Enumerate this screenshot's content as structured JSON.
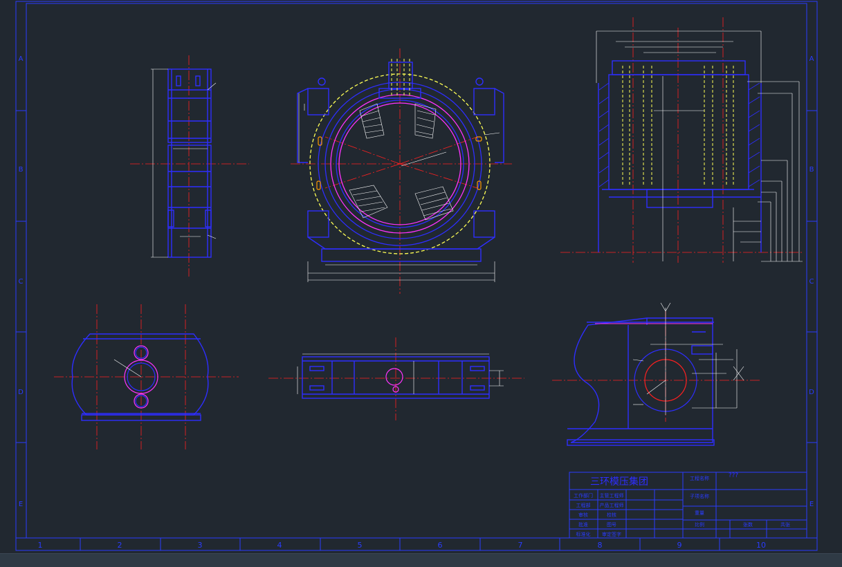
{
  "frame": {
    "column_labels": [
      "1",
      "2",
      "3",
      "4",
      "5",
      "6",
      "7",
      "8",
      "9",
      "10"
    ],
    "row_labels": [
      "A",
      "B",
      "C",
      "D",
      "E"
    ]
  },
  "title_block": {
    "drawing_title": "三环模压集团",
    "top_right_note": "???",
    "rows": [
      [
        "工作部门",
        "主管工程师",
        "",
        "",
        "",
        ""
      ],
      [
        "工程部",
        "产品工程师",
        "",
        "",
        "",
        ""
      ],
      [
        "审核",
        "校核",
        "",
        "",
        "",
        ""
      ],
      [
        "批准",
        "图号",
        "",
        "",
        "",
        ""
      ],
      [
        "标准化",
        "审定签字",
        "",
        "",
        "",
        ""
      ]
    ],
    "side_cells": [
      "工程名称",
      "子项名称",
      "重量",
      "比例",
      "张数",
      "共张"
    ]
  },
  "colors": {
    "background": "#212830",
    "frame": "#2a3cff",
    "geometry": "#2e2eff",
    "centerline": "#ff2020",
    "dimension": "#ffffff",
    "hidden": "#ffff55",
    "accent": "#ff33ff",
    "highlight": "#ff9900"
  }
}
